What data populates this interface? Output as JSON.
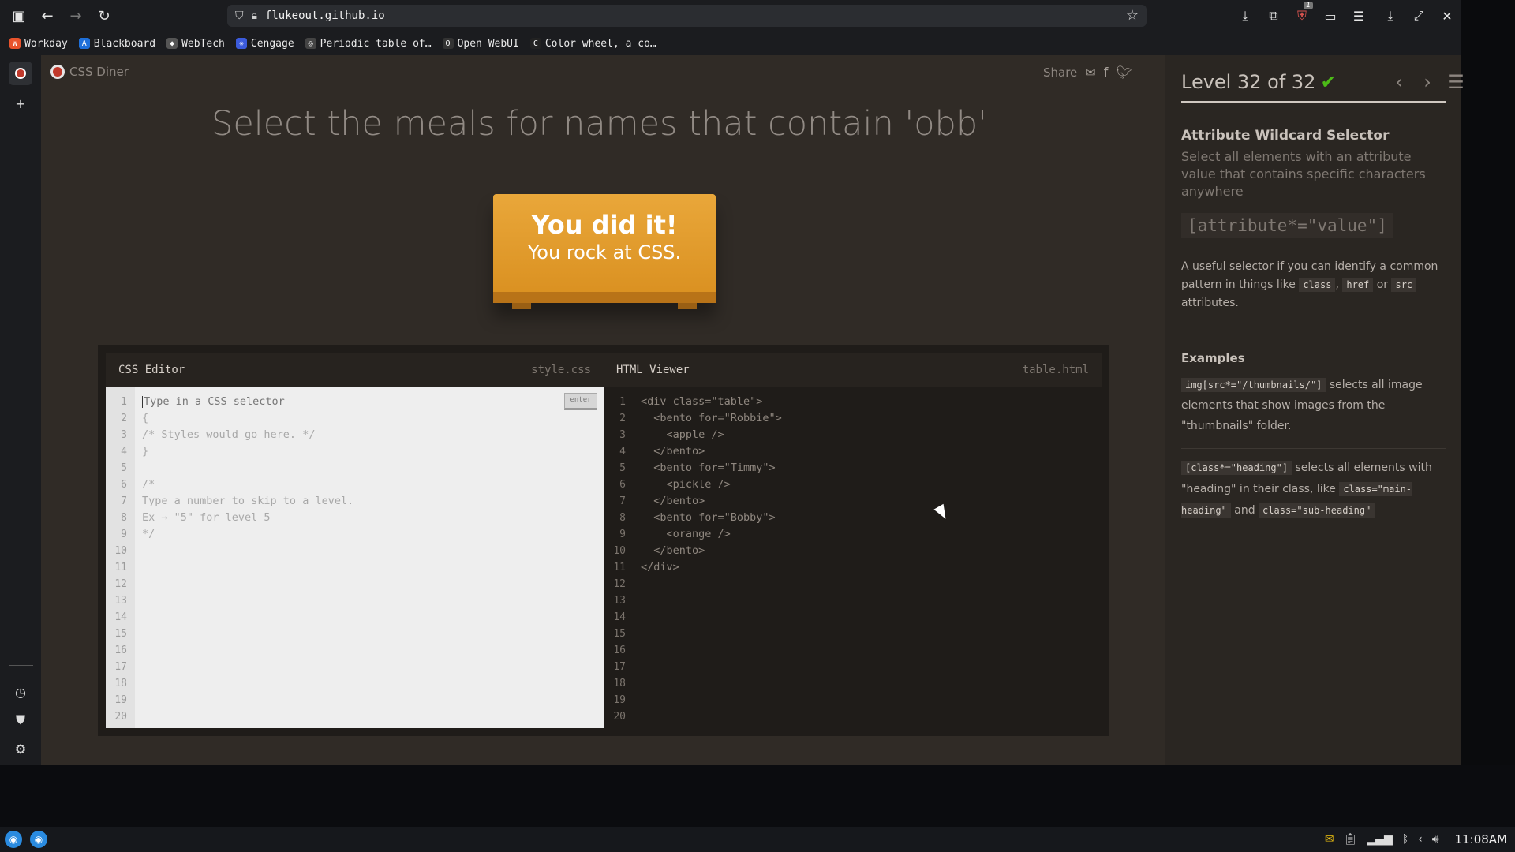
{
  "browser": {
    "url": "flukeout.github.io",
    "bookmarks": [
      {
        "label": "Workday",
        "color": "#e8532c",
        "glyph": "W"
      },
      {
        "label": "Blackboard",
        "color": "#1e6fd9",
        "glyph": "A"
      },
      {
        "label": "WebTech",
        "color": "#555555",
        "glyph": "◆"
      },
      {
        "label": "Cengage",
        "color": "#3b5bdb",
        "glyph": "✳"
      },
      {
        "label": "Periodic table of…",
        "color": "#444444",
        "glyph": "◎"
      },
      {
        "label": "Open WebUI",
        "color": "#333333",
        "glyph": "O"
      },
      {
        "label": "Color wheel, a co…",
        "color": "#222222",
        "glyph": "C"
      }
    ],
    "extension_badge": "1"
  },
  "app": {
    "brand": "CSS Diner",
    "share_label": "Share",
    "headline": "Select the meals for names that contain 'obb'",
    "plate_line1": "You did it!",
    "plate_line2": "You rock at CSS."
  },
  "css_editor": {
    "title": "CSS Editor",
    "file": "style.css",
    "enter_label": "enter",
    "lines": [
      "Type in a CSS selector",
      "{",
      "/* Styles would go here. */",
      "}",
      "",
      "/*",
      "Type a number to skip to a level.",
      "Ex → \"5\" for level 5",
      "*/",
      "",
      "",
      "",
      "",
      "",
      "",
      "",
      "",
      "",
      "",
      ""
    ]
  },
  "html_viewer": {
    "title": "HTML Viewer",
    "file": "table.html",
    "lines": [
      "<div class=\"table\">",
      "  <bento for=\"Robbie\">",
      "    <apple />",
      "  </bento>",
      "  <bento for=\"Timmy\">",
      "    <pickle />",
      "  </bento>",
      "  <bento for=\"Bobby\">",
      "    <orange />",
      "  </bento>",
      "</div>",
      "",
      "",
      "",
      "",
      "",
      "",
      "",
      "",
      ""
    ]
  },
  "level": {
    "label": "Level 32 of 32",
    "current": 32,
    "total": 32,
    "progress_fraction": 1.0,
    "title": "Attribute Wildcard Selector",
    "description": "Select all elements with an attribute value that contains specific characters anywhere",
    "syntax": "[attribute*=\"value\"]",
    "hint_pre": "A useful selector if you can identify a common pattern in things like ",
    "hint_tag1": "class",
    "hint_sep1": ", ",
    "hint_tag2": "href",
    "hint_sep2": " or ",
    "hint_tag3": "src",
    "hint_post": " attributes.",
    "examples_heading": "Examples",
    "ex1_code": "img[src*=\"/thumbnails/\"]",
    "ex1_text": " selects all image elements that show images from the \"thumbnails\" folder.",
    "ex2_code": "[class*=\"heading\"]",
    "ex2_text1": " selects all elements with \"heading\" in their class, like ",
    "ex2_tag1": "class=\"main-heading\"",
    "ex2_text2": " and ",
    "ex2_tag2": "class=\"sub-heading\""
  },
  "taskbar": {
    "clock": "11:08AM"
  },
  "colors": {
    "page_bg": "#302b26",
    "plate": "#e9a73a",
    "check": "#4cbb17"
  }
}
